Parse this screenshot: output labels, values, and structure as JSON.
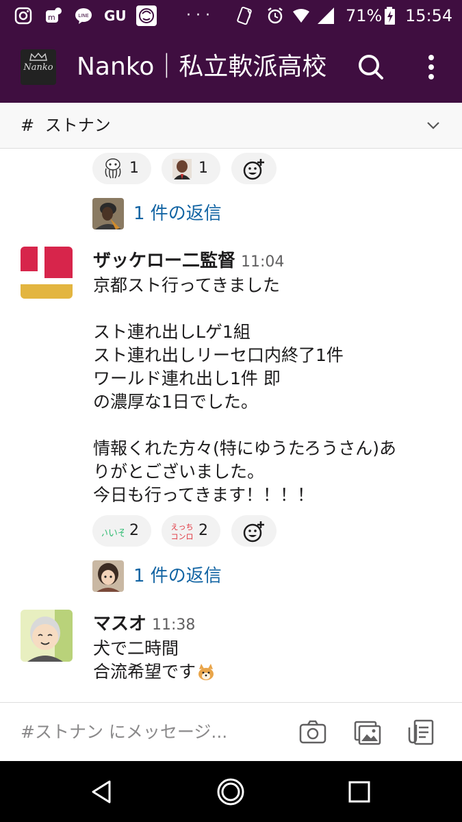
{
  "status_bar": {
    "battery": "71%",
    "time": "15:54",
    "app_icons": [
      "instagram-icon",
      "mercari-icon",
      "line-icon",
      "gu-icon",
      "manga-icon",
      "more-dots-icon"
    ],
    "line_label": "LINE",
    "gu_label": "GU"
  },
  "app_bar": {
    "logo_text": "Nanko",
    "workspace_title": "Nanko｜私立軟派高校",
    "colors": {
      "background": "#3f0e40"
    }
  },
  "channel_bar": {
    "hash": "#",
    "name": "ストナン"
  },
  "messages": [
    {
      "reactions": [
        {
          "emoji": "octopus-emoji",
          "count": "1"
        },
        {
          "emoji": "man-face-emoji",
          "count": "1"
        }
      ],
      "reply_text": "1 件の返信"
    },
    {
      "author": "ザッケロー二監督",
      "time": "11:04",
      "lines": [
        "京都スト行ってきました",
        "",
        "スト連れ出しLゲ1組",
        "スト連れ出しリーセ口内終了1件",
        "ワールド連れ出し1件 即",
        "の濃厚な1日でした。",
        "",
        "情報くれた方々(特にゆうたろうさん)あ",
        "りがとございました。",
        "今日も行ってきます！！！！"
      ],
      "reactions": [
        {
          "emoji": "iize-emoji",
          "label": "いいぞ",
          "count": "2"
        },
        {
          "emoji": "ecchi-konro-emoji",
          "label_top": "えっち",
          "label_bottom": "コンロ",
          "count": "2"
        }
      ],
      "reply_text": "1 件の返信"
    },
    {
      "author": "マスオ",
      "time": "11:38",
      "lines": [
        "犬で二時間",
        "合流希望です"
      ],
      "trailing_emoji": "shiba-dog-emoji"
    }
  ],
  "composer": {
    "placeholder": "#ストナン にメッセージ..."
  },
  "nav": [
    "back-triangle-icon",
    "home-circle-icon",
    "recents-square-icon"
  ]
}
